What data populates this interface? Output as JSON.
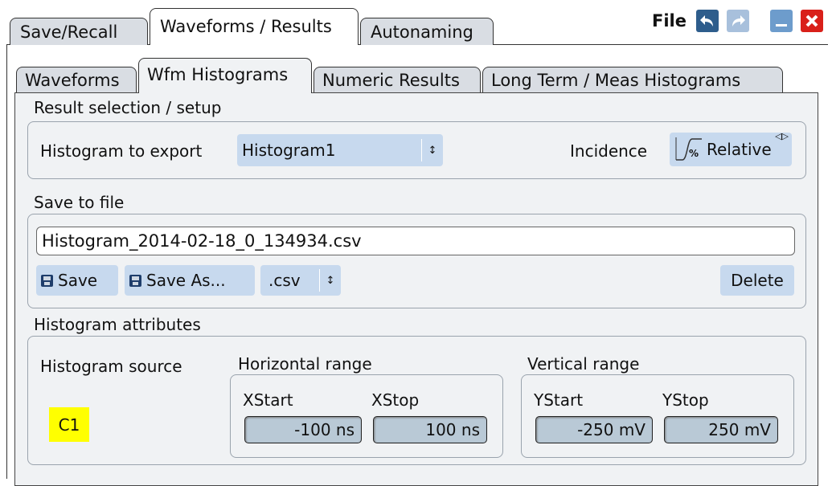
{
  "top_tabs": [
    {
      "label": "Save/Recall"
    },
    {
      "label": "Waveforms / Results"
    },
    {
      "label": "Autonaming"
    }
  ],
  "window": {
    "title": "File"
  },
  "sub_tabs": [
    {
      "label": "Waveforms"
    },
    {
      "label": "Wfm Histograms"
    },
    {
      "label": "Numeric Results"
    },
    {
      "label": "Long Term / Meas Histograms"
    }
  ],
  "result_selection": {
    "title": "Result selection / setup",
    "histogram_label": "Histogram to export",
    "histogram_value": "Histogram1",
    "incidence_label": "Incidence",
    "incidence_value": "Relative",
    "incidence_icon_text": "%"
  },
  "save_to_file": {
    "title": "Save to file",
    "filename": "Histogram_2014-02-18_0_134934.csv",
    "save_label": "Save",
    "save_as_label": "Save As...",
    "format_value": ".csv",
    "delete_label": "Delete"
  },
  "attributes": {
    "title": "Histogram attributes",
    "source_label": "Histogram source",
    "source_value": "C1",
    "source_color": "#ffff00",
    "horizontal": {
      "title": "Horizontal range",
      "xstart_label": "XStart",
      "xstop_label": "XStop",
      "xstart_value": "-100 ns",
      "xstop_value": "100 ns"
    },
    "vertical": {
      "title": "Vertical range",
      "ystart_label": "YStart",
      "ystop_label": "YStop",
      "ystart_value": "-250 mV",
      "ystop_value": "250 mV"
    }
  },
  "icons": [
    "undo-icon",
    "redo-icon",
    "minimize-icon",
    "close-icon",
    "spin-arrows-icon",
    "save-disk-icon",
    "incidence-curve-icon",
    "toggle-arrows-icon"
  ]
}
